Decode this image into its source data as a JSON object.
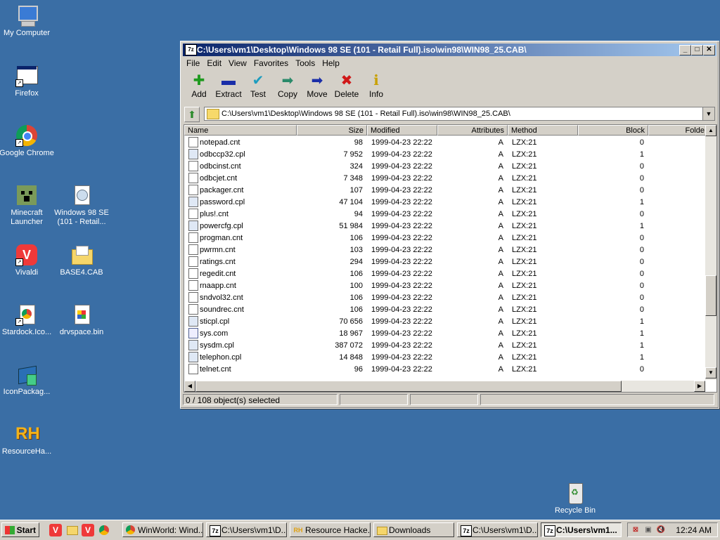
{
  "desktop": {
    "icons": [
      {
        "label": "My Computer"
      },
      {
        "label": "Firefox"
      },
      {
        "label": "Google Chrome"
      },
      {
        "label": "Minecraft Launcher"
      },
      {
        "label": "Windows 98 SE (101 - Retail..."
      },
      {
        "label": "Vivaldi"
      },
      {
        "label": "BASE4.CAB"
      },
      {
        "label": "Stardock.Ico..."
      },
      {
        "label": "drvspace.bin"
      },
      {
        "label": "IconPackag..."
      },
      {
        "label": "ResourceHa..."
      },
      {
        "label": "Recycle Bin"
      }
    ]
  },
  "window": {
    "title": "C:\\Users\\vm1\\Desktop\\Windows 98 SE (101 - Retail Full).iso\\win98\\WIN98_25.CAB\\",
    "app_icon": "7z",
    "menu": [
      "File",
      "Edit",
      "View",
      "Favorites",
      "Tools",
      "Help"
    ],
    "toolbar": [
      {
        "label": "Add",
        "icon": "plus-icon",
        "glyph": "✚",
        "color": "#1f9a1f"
      },
      {
        "label": "Extract",
        "icon": "minus-icon",
        "glyph": "▬",
        "color": "#1a2ea8"
      },
      {
        "label": "Test",
        "icon": "check-icon",
        "glyph": "✔",
        "color": "#1e9dbf"
      },
      {
        "label": "Copy",
        "icon": "copy-arrow-icon",
        "glyph": "➡",
        "color": "#2a8a6a"
      },
      {
        "label": "Move",
        "icon": "move-arrow-icon",
        "glyph": "➡",
        "color": "#1a2ea8"
      },
      {
        "label": "Delete",
        "icon": "delete-x-icon",
        "glyph": "✖",
        "color": "#d01818"
      },
      {
        "label": "Info",
        "icon": "info-icon",
        "glyph": "ℹ",
        "color": "#c8a000"
      }
    ],
    "address": "C:\\Users\\vm1\\Desktop\\Windows 98 SE (101 - Retail Full).iso\\win98\\WIN98_25.CAB\\",
    "columns": [
      "Name",
      "Size",
      "Modified",
      "Attributes",
      "Method",
      "Block",
      "Folde"
    ],
    "files": [
      {
        "name": "notepad.cnt",
        "size": "98",
        "modified": "1999-04-23 22:22",
        "attr": "A",
        "method": "LZX:21",
        "block": "0",
        "type": "cnt"
      },
      {
        "name": "odbccp32.cpl",
        "size": "7 952",
        "modified": "1999-04-23 22:22",
        "attr": "A",
        "method": "LZX:21",
        "block": "1",
        "type": "cpl"
      },
      {
        "name": "odbcinst.cnt",
        "size": "324",
        "modified": "1999-04-23 22:22",
        "attr": "A",
        "method": "LZX:21",
        "block": "0",
        "type": "cnt"
      },
      {
        "name": "odbcjet.cnt",
        "size": "7 348",
        "modified": "1999-04-23 22:22",
        "attr": "A",
        "method": "LZX:21",
        "block": "0",
        "type": "cnt"
      },
      {
        "name": "packager.cnt",
        "size": "107",
        "modified": "1999-04-23 22:22",
        "attr": "A",
        "method": "LZX:21",
        "block": "0",
        "type": "cnt"
      },
      {
        "name": "password.cpl",
        "size": "47 104",
        "modified": "1999-04-23 22:22",
        "attr": "A",
        "method": "LZX:21",
        "block": "1",
        "type": "cpl"
      },
      {
        "name": "plus!.cnt",
        "size": "94",
        "modified": "1999-04-23 22:22",
        "attr": "A",
        "method": "LZX:21",
        "block": "0",
        "type": "cnt"
      },
      {
        "name": "powercfg.cpl",
        "size": "51 984",
        "modified": "1999-04-23 22:22",
        "attr": "A",
        "method": "LZX:21",
        "block": "1",
        "type": "cpl"
      },
      {
        "name": "progman.cnt",
        "size": "106",
        "modified": "1999-04-23 22:22",
        "attr": "A",
        "method": "LZX:21",
        "block": "0",
        "type": "cnt"
      },
      {
        "name": "pwrmn.cnt",
        "size": "103",
        "modified": "1999-04-23 22:22",
        "attr": "A",
        "method": "LZX:21",
        "block": "0",
        "type": "cnt"
      },
      {
        "name": "ratings.cnt",
        "size": "294",
        "modified": "1999-04-23 22:22",
        "attr": "A",
        "method": "LZX:21",
        "block": "0",
        "type": "cnt"
      },
      {
        "name": "regedit.cnt",
        "size": "106",
        "modified": "1999-04-23 22:22",
        "attr": "A",
        "method": "LZX:21",
        "block": "0",
        "type": "cnt"
      },
      {
        "name": "rnaapp.cnt",
        "size": "100",
        "modified": "1999-04-23 22:22",
        "attr": "A",
        "method": "LZX:21",
        "block": "0",
        "type": "cnt"
      },
      {
        "name": "sndvol32.cnt",
        "size": "106",
        "modified": "1999-04-23 22:22",
        "attr": "A",
        "method": "LZX:21",
        "block": "0",
        "type": "cnt"
      },
      {
        "name": "soundrec.cnt",
        "size": "106",
        "modified": "1999-04-23 22:22",
        "attr": "A",
        "method": "LZX:21",
        "block": "0",
        "type": "cnt"
      },
      {
        "name": "sticpl.cpl",
        "size": "70 656",
        "modified": "1999-04-23 22:22",
        "attr": "A",
        "method": "LZX:21",
        "block": "1",
        "type": "cpl"
      },
      {
        "name": "sys.com",
        "size": "18 967",
        "modified": "1999-04-23 22:22",
        "attr": "A",
        "method": "LZX:21",
        "block": "1",
        "type": "com"
      },
      {
        "name": "sysdm.cpl",
        "size": "387 072",
        "modified": "1999-04-23 22:22",
        "attr": "A",
        "method": "LZX:21",
        "block": "1",
        "type": "cpl"
      },
      {
        "name": "telephon.cpl",
        "size": "14 848",
        "modified": "1999-04-23 22:22",
        "attr": "A",
        "method": "LZX:21",
        "block": "1",
        "type": "cpl"
      },
      {
        "name": "telnet.cnt",
        "size": "96",
        "modified": "1999-04-23 22:22",
        "attr": "A",
        "method": "LZX:21",
        "block": "0",
        "type": "cnt"
      }
    ],
    "status": "0 / 108 object(s) selected"
  },
  "taskbar": {
    "start_label": "Start",
    "tasks": [
      {
        "label": "WinWorld: Wind...",
        "icon": "chrome-icon",
        "active": false
      },
      {
        "label": "C:\\Users\\vm1\\D...",
        "icon": "7z-icon",
        "active": false
      },
      {
        "label": "Resource Hacke...",
        "icon": "resourcehacker-icon",
        "active": false
      },
      {
        "label": "Downloads",
        "icon": "folder-icon",
        "active": false
      },
      {
        "label": "C:\\Users\\vm1\\D...",
        "icon": "7z-icon",
        "active": false
      },
      {
        "label": "C:\\Users\\vm1...",
        "icon": "7z-icon",
        "active": true
      }
    ],
    "clock": "12:24 AM"
  }
}
